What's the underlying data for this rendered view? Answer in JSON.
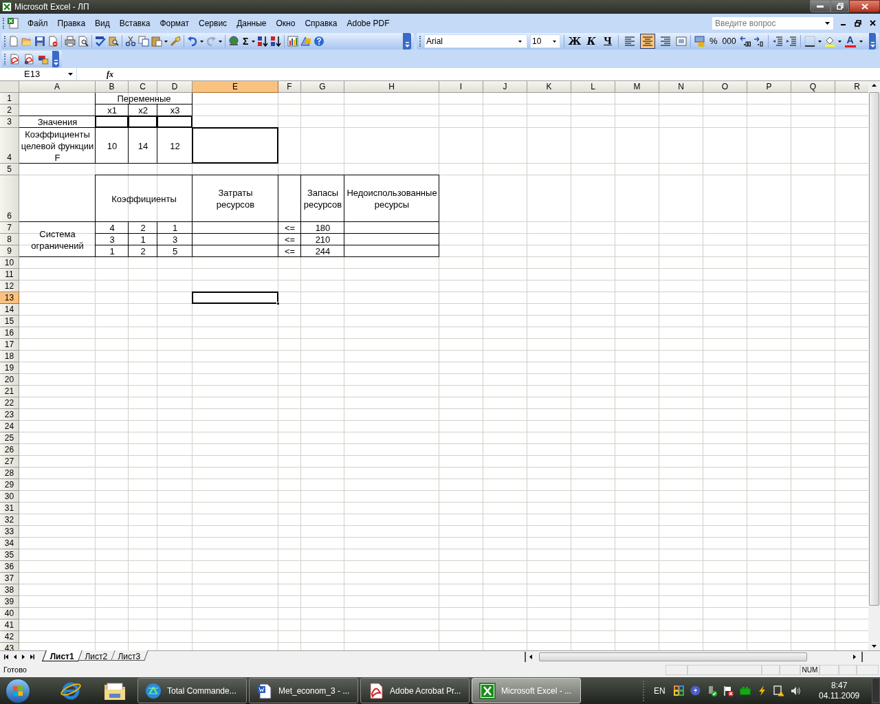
{
  "window": {
    "title": "Microsoft Excel - ЛП"
  },
  "menu": [
    "Файл",
    "Правка",
    "Вид",
    "Вставка",
    "Формат",
    "Сервис",
    "Данные",
    "Окно",
    "Справка",
    "Adobe PDF"
  ],
  "help_box": {
    "placeholder": "Введите вопрос"
  },
  "toolbar": {
    "sum": "Σ"
  },
  "formatting": {
    "font": "Arial",
    "size": "10",
    "bold": "Ж",
    "italic": "К",
    "underline": "Ч",
    "align_buttons": [
      {
        "selected": false
      },
      {
        "selected": true
      },
      {
        "selected": false
      }
    ],
    "percent": "%",
    "thousands": "000",
    "font_color": "A"
  },
  "formula_bar": {
    "name_box": "E13",
    "fx": "fx"
  },
  "sheet": {
    "columns": [
      {
        "label": "A",
        "selected": false
      },
      {
        "label": "B",
        "selected": false
      },
      {
        "label": "C",
        "selected": false
      },
      {
        "label": "D",
        "selected": false
      },
      {
        "label": "E",
        "selected": true
      },
      {
        "label": "F",
        "selected": false
      },
      {
        "label": "G",
        "selected": false
      },
      {
        "label": "H",
        "selected": false
      },
      {
        "label": "I",
        "selected": false
      },
      {
        "label": "J",
        "selected": false
      },
      {
        "label": "K",
        "selected": false
      },
      {
        "label": "L",
        "selected": false
      },
      {
        "label": "M",
        "selected": false
      },
      {
        "label": "N",
        "selected": false
      },
      {
        "label": "O",
        "selected": false
      },
      {
        "label": "P",
        "selected": false
      },
      {
        "label": "Q",
        "selected": false
      },
      {
        "label": "R",
        "selected": false
      }
    ],
    "rows": [
      {
        "label": "1",
        "selected": false
      },
      {
        "label": "2",
        "selected": false
      },
      {
        "label": "3",
        "selected": false
      },
      {
        "label": "4",
        "selected": false
      },
      {
        "label": "5",
        "selected": false
      },
      {
        "label": "6",
        "selected": false
      },
      {
        "label": "7",
        "selected": false
      },
      {
        "label": "8",
        "selected": false
      },
      {
        "label": "9",
        "selected": false
      },
      {
        "label": "10",
        "selected": false
      },
      {
        "label": "11",
        "selected": false
      },
      {
        "label": "12",
        "selected": false
      },
      {
        "label": "13",
        "selected": true
      },
      {
        "label": "14",
        "selected": false
      },
      {
        "label": "15",
        "selected": false
      },
      {
        "label": "16",
        "selected": false
      },
      {
        "label": "17",
        "selected": false
      },
      {
        "label": "18",
        "selected": false
      },
      {
        "label": "19",
        "selected": false
      },
      {
        "label": "20",
        "selected": false
      },
      {
        "label": "21",
        "selected": false
      },
      {
        "label": "22",
        "selected": false
      },
      {
        "label": "23",
        "selected": false
      },
      {
        "label": "24",
        "selected": false
      },
      {
        "label": "25",
        "selected": false
      },
      {
        "label": "26",
        "selected": false
      },
      {
        "label": "27",
        "selected": false
      },
      {
        "label": "28",
        "selected": false
      },
      {
        "label": "29",
        "selected": false
      },
      {
        "label": "30",
        "selected": false
      },
      {
        "label": "31",
        "selected": false
      },
      {
        "label": "32",
        "selected": false
      },
      {
        "label": "33",
        "selected": false
      },
      {
        "label": "34",
        "selected": false
      },
      {
        "label": "35",
        "selected": false
      },
      {
        "label": "36",
        "selected": false
      },
      {
        "label": "37",
        "selected": false
      },
      {
        "label": "38",
        "selected": false
      },
      {
        "label": "39",
        "selected": false
      },
      {
        "label": "40",
        "selected": false
      },
      {
        "label": "41",
        "selected": false
      },
      {
        "label": "42",
        "selected": false
      },
      {
        "label": "43",
        "selected": false
      }
    ],
    "cells": [
      "Переменные",
      "x1",
      "x2",
      "x3",
      "Значения",
      "Коэффициенты целевой функции F",
      "10",
      "14",
      "12",
      "Коэффициенты",
      "Затраты ресурсов",
      "Запасы ресурсов",
      "Недоиспользованные ресурсы",
      "Система ограничений",
      "4",
      "2",
      "1",
      "<=",
      "180",
      "3",
      "1",
      "3",
      "<=",
      "210",
      "1",
      "2",
      "5",
      "<=",
      "244"
    ]
  },
  "sheet_tabs": [
    {
      "label": "Лист1",
      "selected": true
    },
    {
      "label": "Лист2",
      "selected": false
    },
    {
      "label": "Лист3",
      "selected": false
    }
  ],
  "status_bar": {
    "text": "Готово",
    "indicator": "NUM"
  },
  "taskbar": {
    "buttons": [
      {
        "label": "Total Commande...",
        "selected": false
      },
      {
        "label": "Met_econom_3 - ...",
        "selected": false
      },
      {
        "label": "Adobe Acrobat Pr...",
        "selected": false
      },
      {
        "label": "Microsoft Excel - ...",
        "selected": true
      }
    ],
    "language": "EN",
    "time": "8:47",
    "date": "04.11.2009"
  }
}
